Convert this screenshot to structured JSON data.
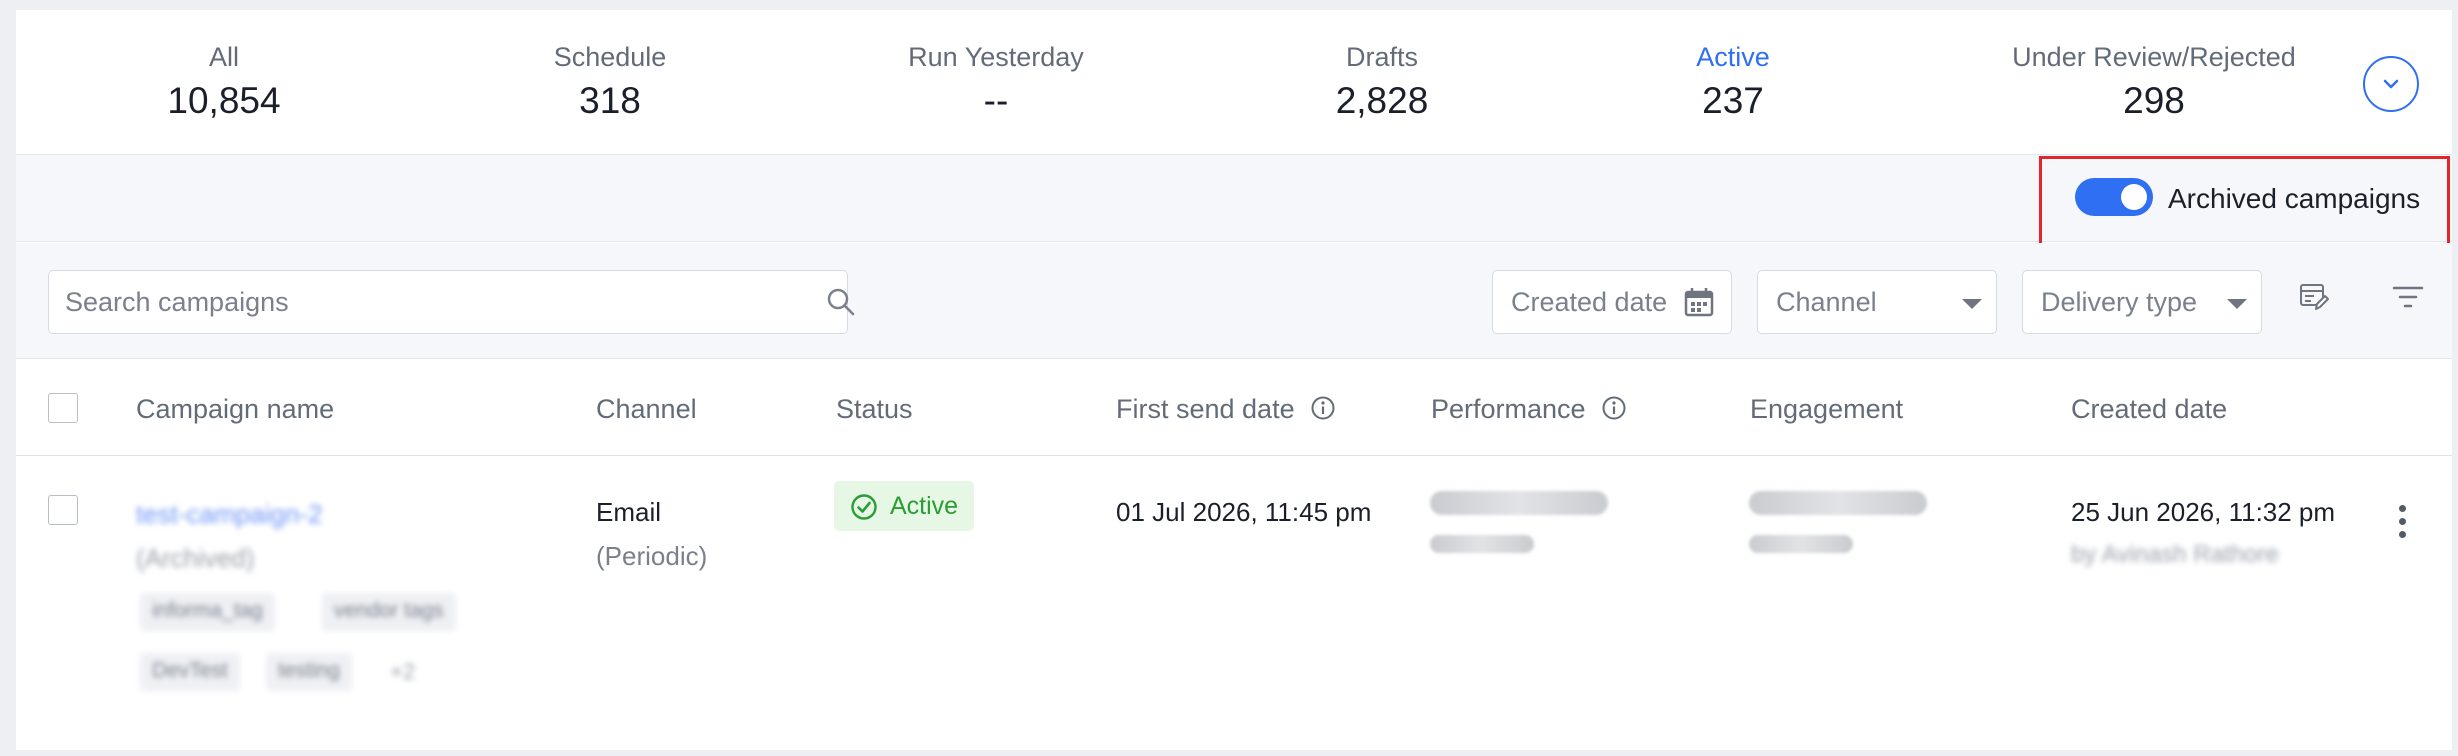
{
  "tabs": [
    {
      "label": "All",
      "count": "10,854"
    },
    {
      "label": "Schedule",
      "count": "318"
    },
    {
      "label": "Run Yesterday",
      "count": "--"
    },
    {
      "label": "Drafts",
      "count": "2,828"
    },
    {
      "label": "Active",
      "count": "237"
    },
    {
      "label": "Under Review/Rejected",
      "count": "298"
    }
  ],
  "active_tab": "Active",
  "archived": {
    "label": "Archived campaigns",
    "enabled": true
  },
  "search": {
    "placeholder": "Search campaigns"
  },
  "filters": {
    "created_date": "Created date",
    "channel": "Channel",
    "delivery_type": "Delivery type"
  },
  "columns": {
    "campaign_name": "Campaign name",
    "channel": "Channel",
    "status": "Status",
    "first_send_date": "First send date",
    "performance": "Performance",
    "engagement": "Engagement",
    "created_date": "Created date"
  },
  "rows": [
    {
      "name": "test-campaign-2",
      "archived_note": "(Archived)",
      "tags": [
        "informa_tag",
        "vendor tags",
        "DevTest",
        "testing"
      ],
      "more_tags": "+2",
      "channel": "Email",
      "channel_sub": "(Periodic)",
      "status": "Active",
      "first_send_date": "01 Jul 2026, 11:45 pm",
      "created_date": "25 Jun 2026, 11:32 pm",
      "created_by": "by Avinash Rathore"
    }
  ],
  "colors": {
    "accent": "#2f6ff2",
    "highlight": "#e3262c",
    "success": "#2a9d34"
  }
}
